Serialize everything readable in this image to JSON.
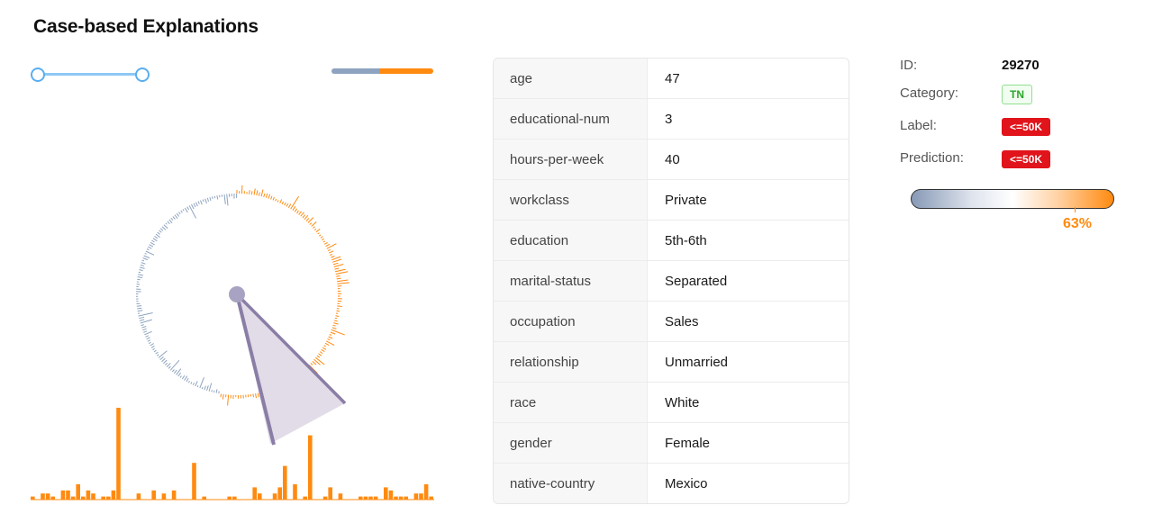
{
  "title": "Case-based Explanations",
  "features": [
    {
      "name": "age",
      "value": "47"
    },
    {
      "name": "educational-num",
      "value": "3"
    },
    {
      "name": "hours-per-week",
      "value": "40"
    },
    {
      "name": "workclass",
      "value": "Private"
    },
    {
      "name": "education",
      "value": "5th-6th"
    },
    {
      "name": "marital-status",
      "value": "Separated"
    },
    {
      "name": "occupation",
      "value": "Sales"
    },
    {
      "name": "relationship",
      "value": "Unmarried"
    },
    {
      "name": "race",
      "value": "White"
    },
    {
      "name": "gender",
      "value": "Female"
    },
    {
      "name": "native-country",
      "value": "Mexico"
    }
  ],
  "info": {
    "id_label": "ID:",
    "id_value": "29270",
    "category_label": "Category:",
    "category_value": "TN",
    "label_label": "Label:",
    "label_value": "<=50K",
    "prediction_label": "Prediction:",
    "prediction_value": "<=50K",
    "probability_text": "63%",
    "probability": 0.63
  },
  "ratio_bar": {
    "negative_fraction": 0.47,
    "positive_fraction": 0.53
  },
  "colors": {
    "negative": "#8ea3bf",
    "positive": "#ff8a10",
    "slider": "#5aaef0",
    "badge_red": "#e0141a",
    "badge_green": "#2ca52c"
  },
  "histogram_heights": [
    1,
    0,
    2,
    2,
    1,
    0,
    3,
    3,
    1,
    5,
    1,
    3,
    2,
    0,
    1,
    1,
    3,
    30,
    0,
    0,
    0,
    2,
    0,
    0,
    3,
    0,
    2,
    0,
    3,
    0,
    0,
    0,
    12,
    0,
    1,
    0,
    0,
    0,
    0,
    1,
    1,
    0,
    0,
    0,
    4,
    2,
    0,
    0,
    2,
    4,
    11,
    0,
    5,
    0,
    1,
    21,
    0,
    0,
    1,
    4,
    0,
    2,
    0,
    0,
    0,
    1,
    1,
    1,
    1,
    0,
    4,
    3,
    1,
    1,
    1,
    0,
    2,
    2,
    5,
    1
  ]
}
